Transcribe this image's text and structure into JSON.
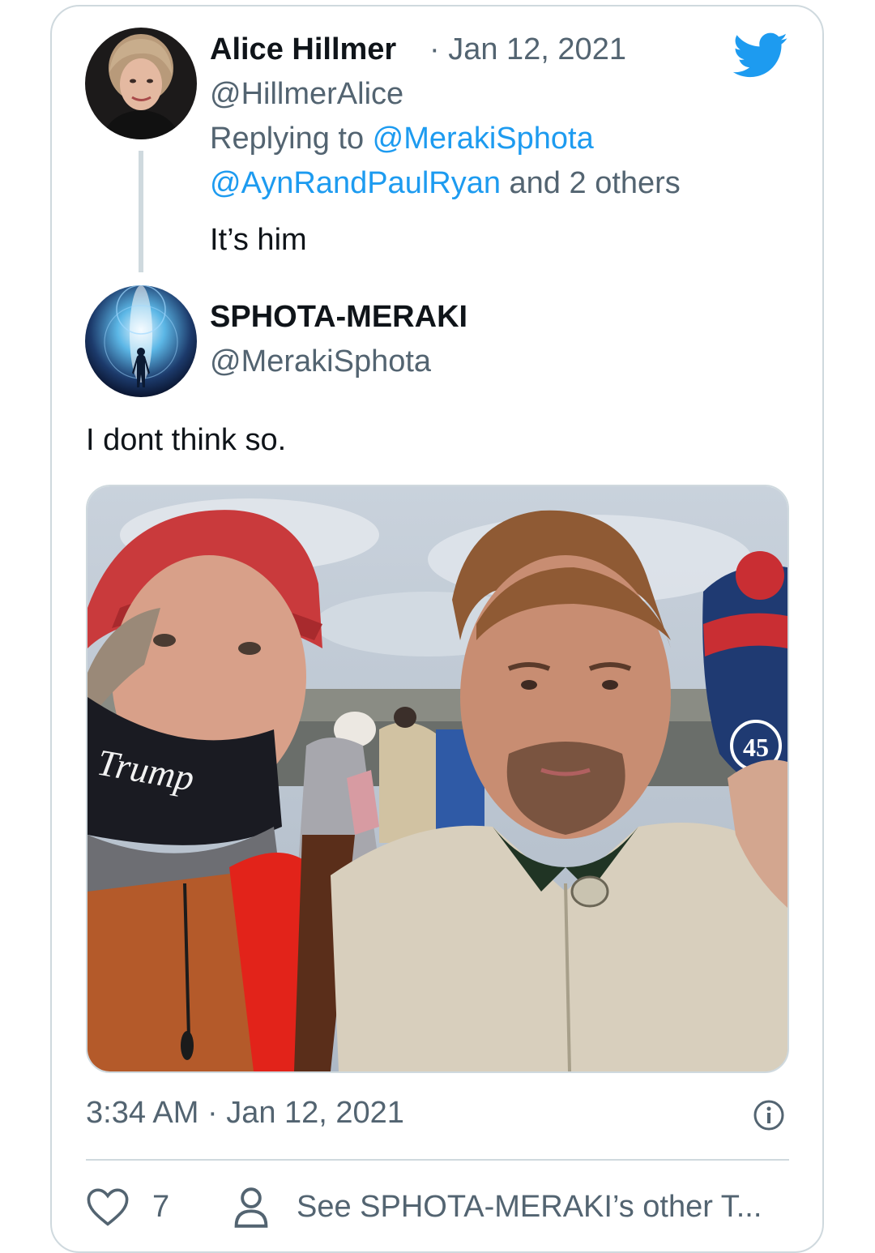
{
  "reply_tweet": {
    "author_name": "Alice Hillmer",
    "date": "· Jan 12, 2021",
    "handle": "@HillmerAlice",
    "replying_prefix": "Replying to ",
    "replying_to": "@MerakiSphota",
    "replying_line2_handle": "@AynRandPaulRyan",
    "replying_line2_rest": " and 2 others",
    "text": "It’s him"
  },
  "main_tweet": {
    "author_name": "SPHOTA-MERAKI",
    "handle": "@MerakiSphota",
    "text": "I dont think so.",
    "photo": {
      "mask_text": "Trump",
      "beanie_badge": "45"
    },
    "timestamp": "3:34 AM · Jan 12, 2021",
    "like_count": "7",
    "other_tweets_link": "See SPHOTA-MERAKI’s other T..."
  },
  "icons": {
    "brand": "twitter-bird-icon",
    "info": "info-icon",
    "like": "heart-icon",
    "profile": "person-icon"
  },
  "colors": {
    "twitter_blue": "#1d9bf0",
    "muted_text": "#536471",
    "border": "#cfd9de"
  }
}
